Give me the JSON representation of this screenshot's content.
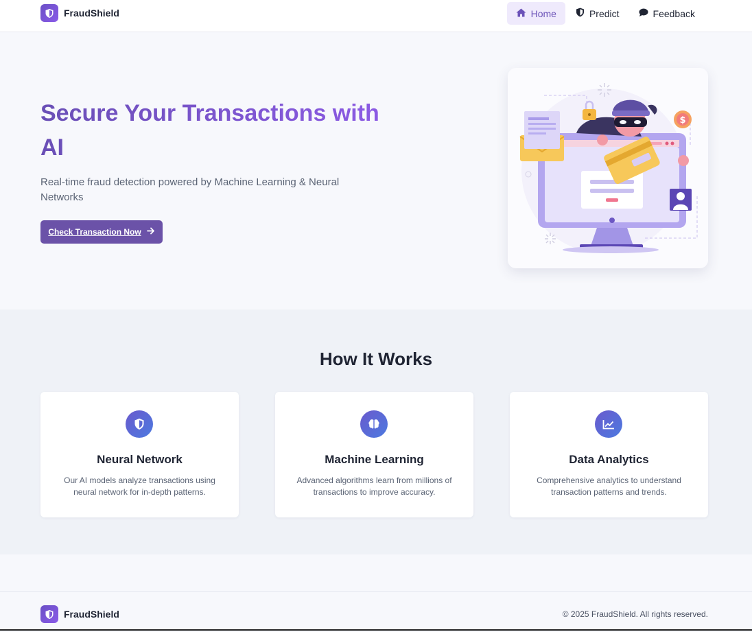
{
  "brand": {
    "name": "FraudShield",
    "icon": "shield-icon"
  },
  "nav": {
    "items": [
      {
        "label": "Home",
        "icon": "home-icon",
        "active": true
      },
      {
        "label": "Predict",
        "icon": "shield-icon",
        "active": false
      },
      {
        "label": "Feedback",
        "icon": "comment-icon",
        "active": false
      }
    ]
  },
  "hero": {
    "title": "Secure Your Transactions with AI",
    "subtitle": "Real-time fraud detection powered by Machine Learning & Neural Networks",
    "cta_label": "Check Transaction Now",
    "cta_icon": "arrow-right-icon"
  },
  "how": {
    "title": "How It Works",
    "cards": [
      {
        "title": "Neural Network",
        "icon": "shield-icon",
        "desc": "Our AI models analyze transactions using neural network for in-depth patterns."
      },
      {
        "title": "Machine Learning",
        "icon": "brain-icon",
        "desc": "Advanced algorithms learn from millions of transactions to improve accuracy."
      },
      {
        "title": "Data Analytics",
        "icon": "chart-line-icon",
        "desc": "Comprehensive analytics to understand transaction patterns and trends."
      }
    ]
  },
  "footer": {
    "brand": "FraudShield",
    "copyright": "© 2025 FraudShield. All rights reserved."
  },
  "colors": {
    "accent": "#6b52a8",
    "accent_light": "#efeafc",
    "gradient_start": "#6a4fb6",
    "gradient_end": "#8d5be6"
  }
}
